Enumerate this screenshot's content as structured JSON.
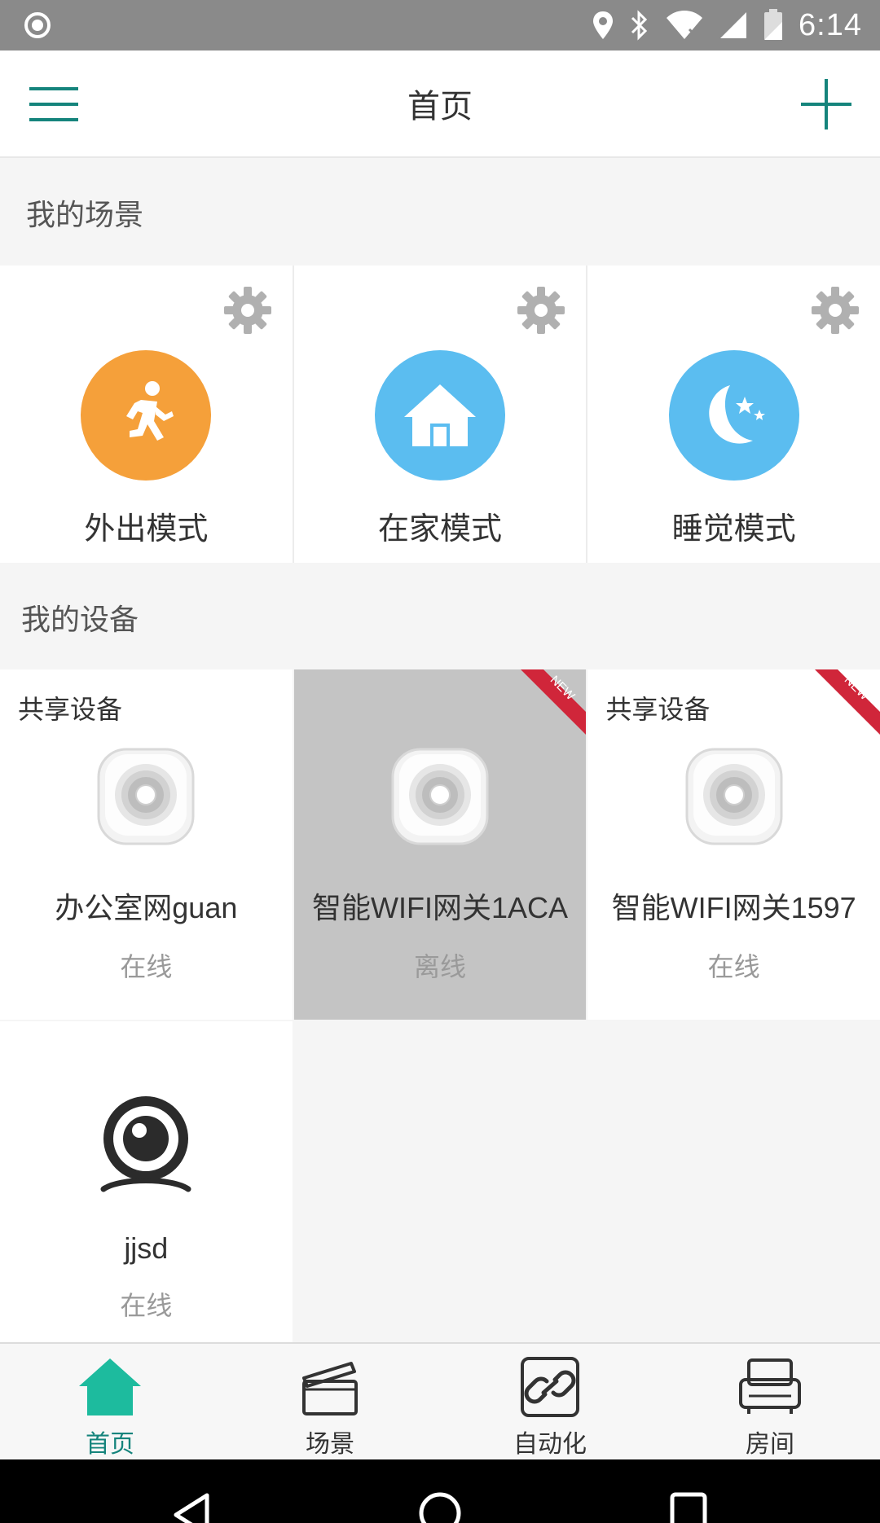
{
  "status_bar": {
    "time": "6:14",
    "icons": [
      "record-icon",
      "location-icon",
      "bluetooth-icon",
      "wifi-icon",
      "signal-icon",
      "battery-icon"
    ]
  },
  "app_bar": {
    "title": "首页",
    "menu_icon": "menu-icon",
    "add_icon": "plus-icon"
  },
  "scenes": {
    "title": "我的场景",
    "items": [
      {
        "label": "外出模式",
        "icon": "running-person-icon",
        "color": "#f5a03a"
      },
      {
        "label": "在家模式",
        "icon": "house-icon",
        "color": "#5bbdf0"
      },
      {
        "label": "睡觉模式",
        "icon": "moon-stars-icon",
        "color": "#5bbdf0"
      }
    ]
  },
  "devices": {
    "title": "我的设备",
    "items": [
      {
        "tag": "共享设备",
        "name": "办公室网guan",
        "status": "在线",
        "is_new": false,
        "offline": false
      },
      {
        "tag": "",
        "name": "智能WIFI网关1ACA",
        "status": "离线",
        "is_new": true,
        "offline": true
      },
      {
        "tag": "共享设备",
        "name": "智能WIFI网关1597",
        "status": "在线",
        "is_new": true,
        "offline": false
      },
      {
        "tag": "",
        "name": "jjsd",
        "status": "在线",
        "is_new": false,
        "offline": false
      }
    ],
    "new_badge": "NEW"
  },
  "bottom_nav": {
    "items": [
      {
        "label": "首页",
        "icon": "home-icon",
        "active": true
      },
      {
        "label": "场景",
        "icon": "clapperboard-icon",
        "active": false
      },
      {
        "label": "自动化",
        "icon": "link-icon",
        "active": false
      },
      {
        "label": "房间",
        "icon": "sofa-icon",
        "active": false
      }
    ]
  },
  "colors": {
    "accent": "#15847c",
    "home_icon": "#1dbb9e",
    "new_ribbon": "#d0263a"
  }
}
